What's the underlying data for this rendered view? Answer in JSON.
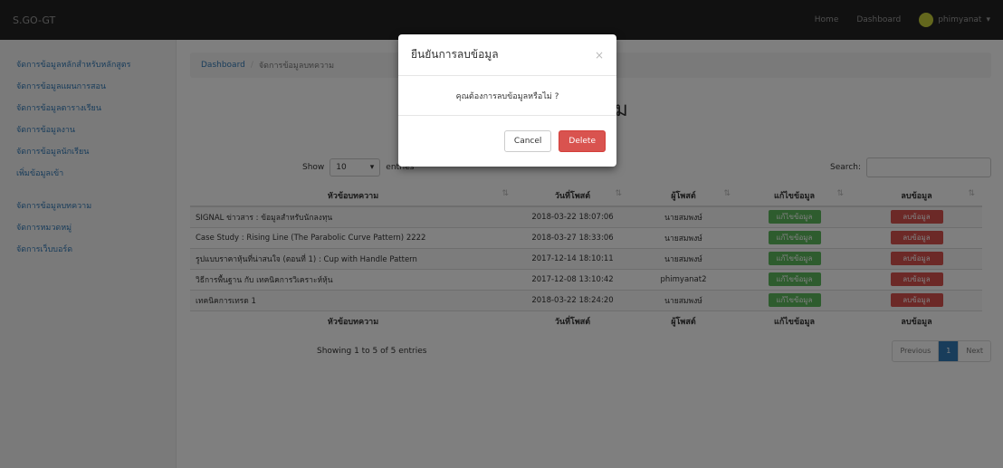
{
  "navbar": {
    "brand": "S.GO-GT",
    "links": [
      "Home",
      "Dashboard"
    ],
    "user": "phimyanat"
  },
  "sidebar": {
    "items": [
      "จัดการข้อมูลหลักสำหรับหลักสูตร",
      "จัดการข้อมูลแผนการสอน",
      "จัดการข้อมูลตารางเรียน",
      "จัดการข้อมูลงาน",
      "จัดการข้อมูลนักเรียน",
      "เพิ่มข้อมูลเข้า",
      "จัดการข้อมูลบทความ",
      "จัดการหมวดหมู่",
      "จัดการเว็บบอร์ด"
    ]
  },
  "breadcrumb": {
    "home": "Dashboard",
    "current": "จัดการข้อมูลบทความ"
  },
  "page": {
    "title": "บทความ",
    "subtitle": "เรื่อง"
  },
  "controls": {
    "show_label": "Show",
    "page_size": "10",
    "entries_label": "entries",
    "search_label": "Search:",
    "search_value": ""
  },
  "table": {
    "headers": [
      "หัวข้อบทความ",
      "วันที่โพสต์",
      "ผู้โพสต์",
      "แก้ไขข้อมูล",
      "ลบข้อมูล"
    ],
    "rows": [
      {
        "title": "SIGNAL ข่าวสาร : ข้อมูลสำหรับนักลงทุน",
        "date": "2018-03-22 18:07:06",
        "author": "นายสมพงษ์",
        "edit": "แก้ไขข้อมูล",
        "delete": "ลบข้อมูล"
      },
      {
        "title": "Case Study : Rising Line (The Parabolic Curve Pattern) 2222",
        "date": "2018-03-27 18:33:06",
        "author": "นายสมพงษ์",
        "edit": "แก้ไขข้อมูล",
        "delete": "ลบข้อมูล"
      },
      {
        "title": "รูปแบบราคาหุ้นที่น่าสนใจ (ตอนที่ 1) : Cup with Handle Pattern",
        "date": "2017-12-14 18:10:11",
        "author": "นายสมพงษ์",
        "edit": "แก้ไขข้อมูล",
        "delete": "ลบข้อมูล"
      },
      {
        "title": "วิธีการพื้นฐาน กับ เทคนิคการวิเคราะห์หุ้น",
        "date": "2017-12-08 13:10:42",
        "author": "phimyanat2",
        "edit": "แก้ไขข้อมูล",
        "delete": "ลบข้อมูล"
      },
      {
        "title": "เทคนิคการเทรด 1",
        "date": "2018-03-22 18:24:20",
        "author": "นายสมพงษ์",
        "edit": "แก้ไขข้อมูล",
        "delete": "ลบข้อมูล"
      }
    ]
  },
  "footer": {
    "info": "Showing 1 to 5 of 5 entries",
    "prev": "Previous",
    "page": "1",
    "next": "Next"
  },
  "modal": {
    "title": "ยืนยันการลบข้อมูล",
    "close": "×",
    "body": "คุณต้องการลบข้อมูลหรือไม่ ?",
    "cancel": "Cancel",
    "delete": "Delete"
  }
}
